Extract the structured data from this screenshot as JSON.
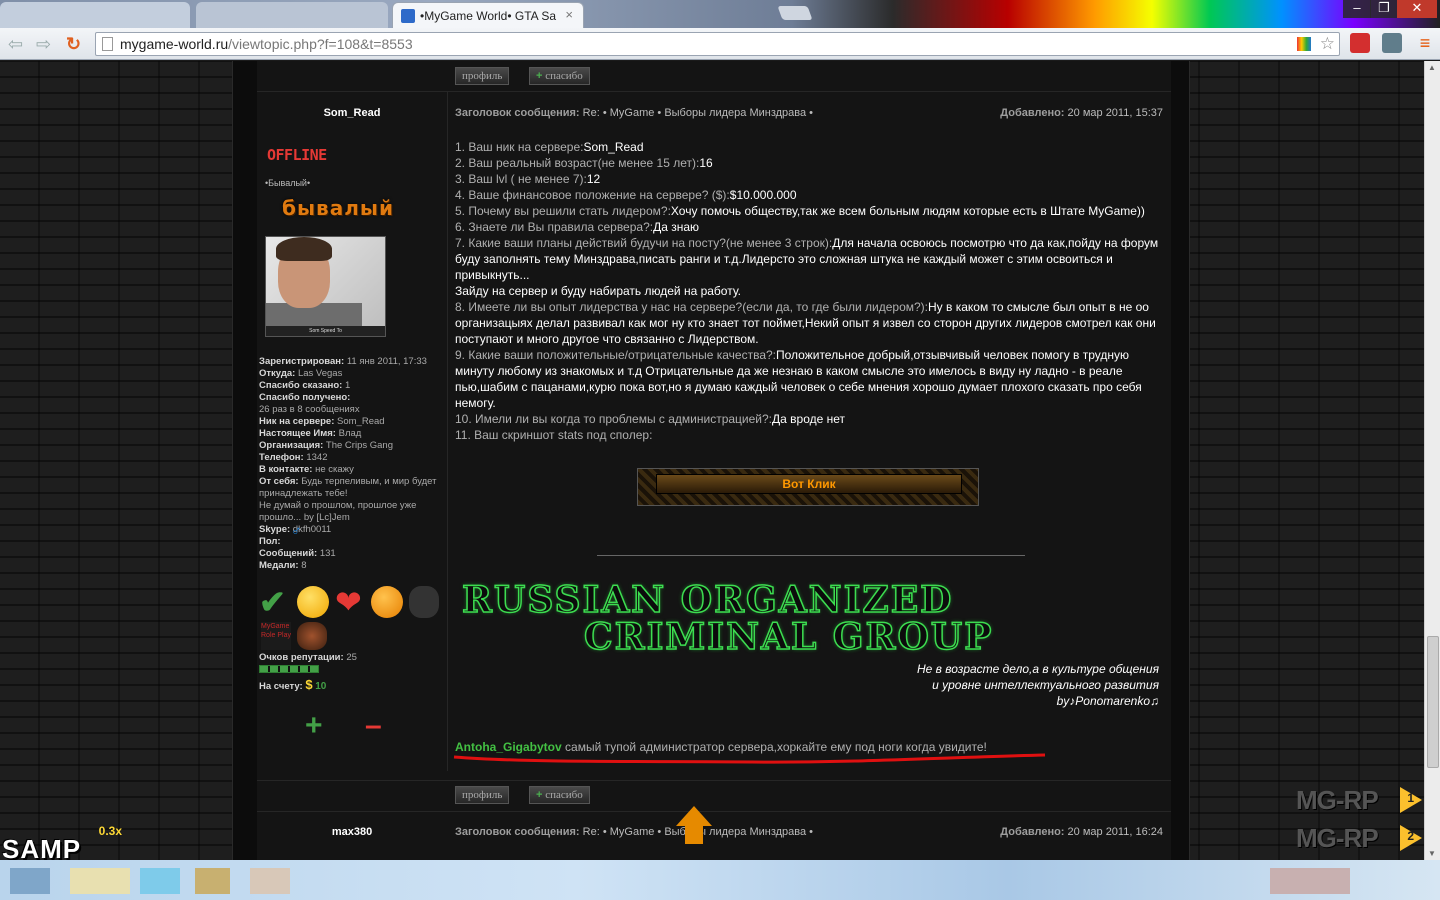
{
  "browser": {
    "active_tab_title": "•MyGame World• GTA Sa",
    "tab_close": "×",
    "url_domain": "mygame-world.ru",
    "url_path": "/viewtopic.php?f=108&t=8553",
    "win_min": "–",
    "win_max": "❐",
    "win_close": "✕"
  },
  "buttons": {
    "profile": "профиль",
    "thanks_plus": "+",
    "thanks": "спасибо"
  },
  "post1": {
    "author": "Som_Read",
    "subject_label": "Заголовок сообщения:",
    "subject": "Re: • MyGame • Выборы лидера Минздрава •",
    "added_label": "Добавлено:",
    "added": "20 мар 2011, 15:37",
    "status": "OFFLINE",
    "rank": "•Бывалый•",
    "rank_image": "бывалый",
    "avatar_caption": "Som Speed To",
    "profile": [
      {
        "label": "Зарегистрирован:",
        "value": "11 янв 2011, 17:33"
      },
      {
        "label": "Откуда:",
        "value": "Las Vegas"
      },
      {
        "label": "Спасибо сказано:",
        "value": "1"
      },
      {
        "label": "Спасибо получено:",
        "value": ""
      },
      {
        "label": "",
        "value": "26 раз в 8 сообщениях"
      },
      {
        "label": "Ник на сервере:",
        "value": "Som_Read"
      },
      {
        "label": "Настоящее Имя:",
        "value": "Влад"
      },
      {
        "label": "Организация:",
        "value": "The Crips Gang"
      },
      {
        "label": "Телефон:",
        "value": "1342"
      },
      {
        "label": "В контакте:",
        "value": "не скажу"
      },
      {
        "label": "От себя:",
        "value": "Будь терпеливым, и мир будет принадлежать тебе!"
      },
      {
        "label": "",
        "value": "Не думай о прошлом, прошлое уже прошло... by [Lc]Jem"
      },
      {
        "label": "Skype:",
        "value": "dkfh0011"
      },
      {
        "label": "Пол:",
        "value": ""
      },
      {
        "label": "Сообщений:",
        "value": "131"
      },
      {
        "label": "Медали:",
        "value": "8"
      }
    ],
    "medal2_text": "MyGame Role Play",
    "reputation_label": "Очков репутации:",
    "reputation": "25",
    "account_label": "На счету:",
    "account_currency": "$",
    "account_value": "10",
    "vote_plus": "+",
    "vote_minus": "–",
    "answers": [
      {
        "q": "1. Ваш ник на сервере:",
        "a": "Som_Read"
      },
      {
        "q": "2. Ваш реальный возраст(не менее 15 лет):",
        "a": "16"
      },
      {
        "q": "3. Ваш lvl ( не менее 7):",
        "a": "12"
      },
      {
        "q": "4. Ваше финансовое положение на сервере? ($):",
        "a": "$10.000.000"
      },
      {
        "q": "5. Почему вы решили стать лидером?:",
        "a": "Хочу помочь обществу,так же всем больным людям которые есть в Штате MyGame))"
      },
      {
        "q": "6. Знаете ли Вы правила сервера?:",
        "a": "Да знаю"
      },
      {
        "q": "7. Какие ваши планы действий будучи на посту?(не менее 3 строк):",
        "a": "Для начала освоюсь посмотрю что да как,пойду на форум буду заполнять тему Минздрава,писать ранги и т.д.Лидерсто это сложная штука не каждый может с этим освоиться и привыкнуть..."
      },
      {
        "q": "",
        "a": "Зайду на сервер и буду набирать людей на работу."
      },
      {
        "q": "8. Имеете ли вы опыт лидерства у нас на сервере?(если да, то где были лидером?):",
        "a": "Ну в каком то смысле был опыт в не оо организацыях делал развивал как мог ну кто знает тот поймет,Некий опыт я извел со сторон других лидеров смотрел как они поступают и много другое что связанно с Лидерством."
      },
      {
        "q": "9. Какие ваши положительные/отрицательные качества?:",
        "a": "Положительное добрый,отзывчивый человек помогу в трудную минуту любому из знакомых и т.д Отрицательные да же незнаю в каком смысле это имелось в виду ну ладно - в реале пью,шабим с пацанами,курю пока вот,но я думаю каждый человек о себе мнения хорошо думает плохого сказать про себя немогу."
      },
      {
        "q": "10. Имели ли вы когда то проблемы с администрацией?:",
        "a": "Да вроде нет"
      },
      {
        "q": "11. Ваш скриншот stats под сполер:",
        "a": ""
      }
    ],
    "spoiler_label": "Вот Клик",
    "sig_line1": "RUSSIAN ORGANIZED",
    "sig_line2": "CRIMINAL GROUP",
    "sig_quote1": "Не в возрасте дело,а в культуре общения",
    "sig_quote2": "и уровне интеллектуального развития",
    "sig_quote3": "by♪Ponomarenko♫",
    "sig_name": "Antoha_Gigabytov",
    "sig_text": " самый тупой администратор сервера,хоркайте ему под ноги когда увидите!"
  },
  "post2": {
    "author": "max380",
    "subject_label": "Заголовок сообщения:",
    "subject": "Re: • MyGame • Выборы лидера Минздрава •",
    "added_label": "Добавлено:",
    "added": "20 мар 2011, 16:24"
  },
  "overlays": {
    "samp_version": "0.3x",
    "samp": "SAMP",
    "mgrp": "MG-RP",
    "mgrp1": "1",
    "mgrp2": "2"
  },
  "colors": {
    "answer": "#ffffff",
    "question": "#b0b0b0",
    "offline": "#e53935",
    "sig_green": "#3ddc50",
    "accent_orange": "#ff9800"
  }
}
